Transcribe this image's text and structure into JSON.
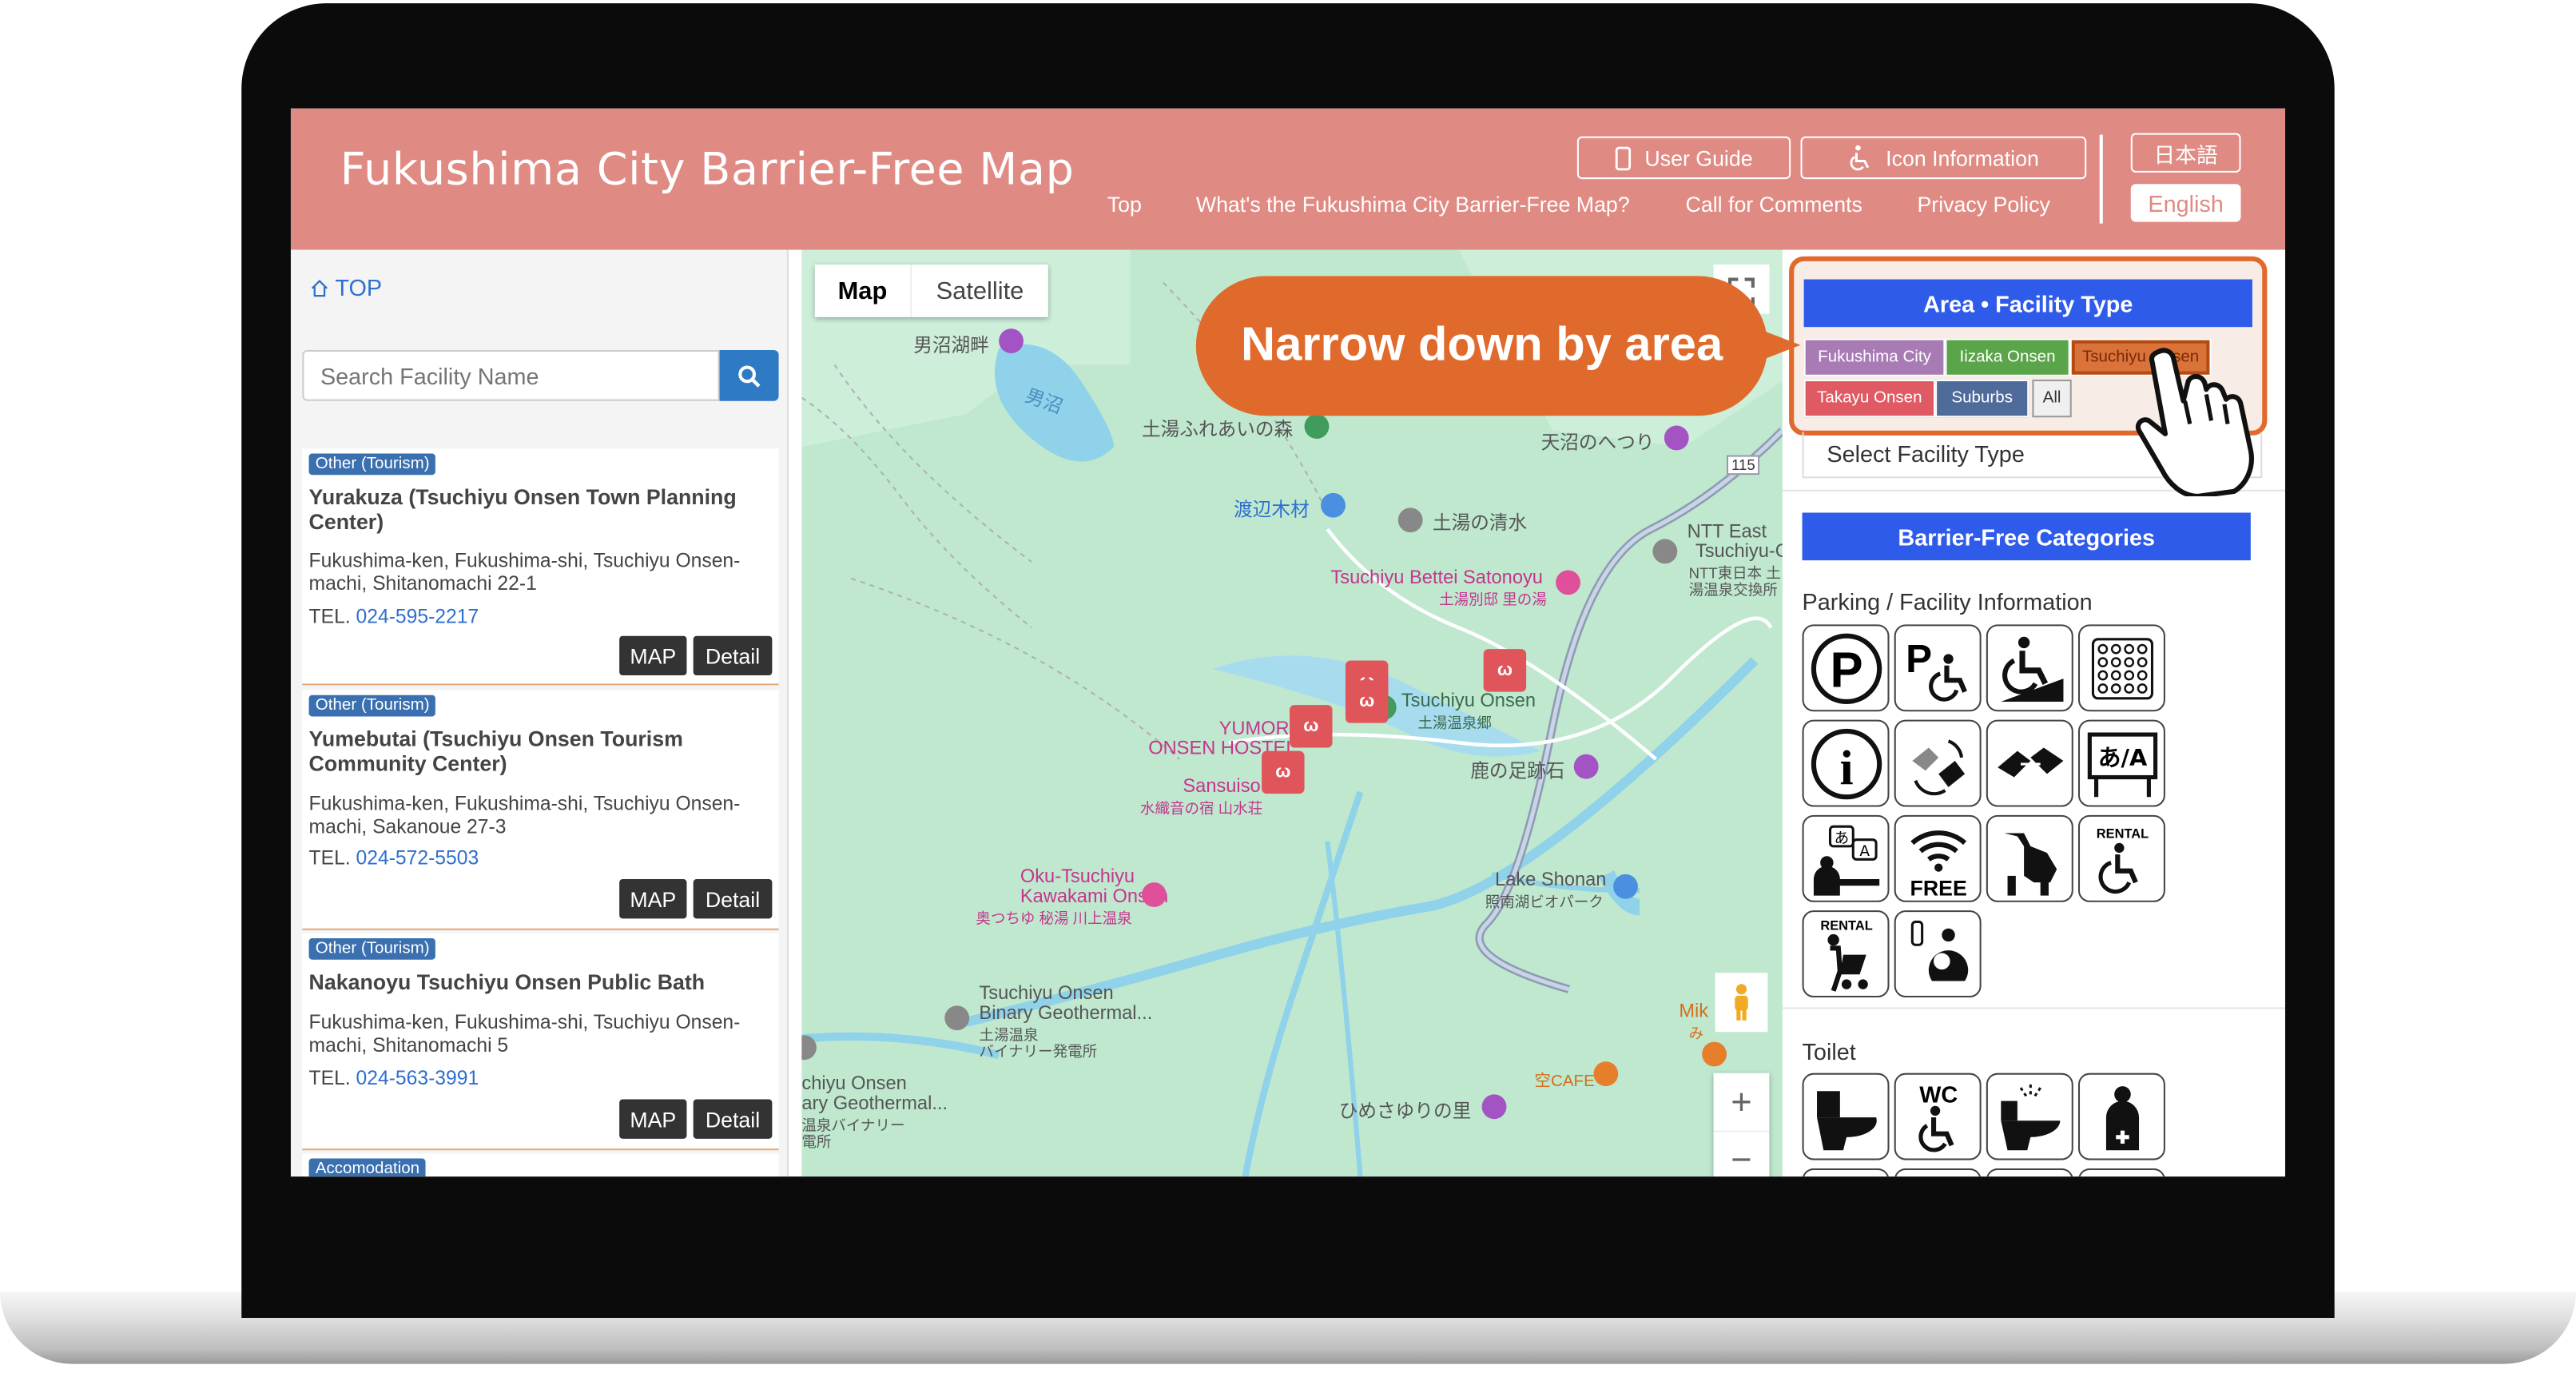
{
  "header": {
    "title": "Fukushima City Barrier-Free Map",
    "user_guide": "User Guide",
    "icon_information": "Icon Information",
    "nav": [
      "Top",
      "What's the Fukushima City Barrier-Free Map?",
      "Call for Comments",
      "Privacy Policy"
    ],
    "lang_ja": "日本語",
    "lang_en": "English"
  },
  "sidebar": {
    "top_link": "TOP",
    "search_placeholder": "Search Facility Name",
    "map_btn": "MAP",
    "detail_btn": "Detail",
    "results": [
      {
        "tag": "Other (Tourism)",
        "name": "Yurakuza (Tsuchiyu Onsen Town Planning Center)",
        "address": "Fukushima-ken, Fukushima-shi, Tsuchiyu Onsen-machi, Shitanomachi 22-1",
        "tel_label": "TEL.",
        "tel": "024-595-2217"
      },
      {
        "tag": "Other (Tourism)",
        "name": "Yumebutai (Tsuchiyu Onsen Tourism Community Center)",
        "address": "Fukushima-ken, Fukushima-shi, Tsuchiyu Onsen-machi, Sakanoue 27-3",
        "tel_label": "TEL.",
        "tel": "024-572-5503"
      },
      {
        "tag": "Other (Tourism)",
        "name": "Nakanoyu Tsuchiyu Onsen Public Bath",
        "address": "Fukushima-ken, Fukushima-shi, Tsuchiyu Onsen-machi, Shitanomachi 5",
        "tel_label": "TEL.",
        "tel": "024-563-3991"
      },
      {
        "tag": "Accomodation"
      }
    ]
  },
  "map": {
    "type_map": "Map",
    "type_satellite": "Satellite",
    "labels": {
      "onuma_lake": "男沼湖畔",
      "onuma": "男沼",
      "fureai": "土湯ふれあいの森",
      "tennuma": "天沼のへつり",
      "watanabe": "渡辺木材",
      "shimizu": "土湯の清水",
      "ntt1": "NTT East",
      "ntt2": "Tsuchiyu-O",
      "ntt3": "NTT東日本 土",
      "ntt4": "湯温泉交換所",
      "route": "115",
      "satonoyu": "Tsuchiyu Bettei Satonoyu",
      "satonoyu_jp": "土湯別邸 里の湯",
      "tsuchiyu_onsen": "Tsuchiyu Onsen",
      "tsuchiyu_jp": "土湯温泉郷",
      "yumori1": "YUMORI",
      "yumori2": "ONSEN HOSTEL",
      "sansuiso": "Sansuiso",
      "sansuiso_jp": "水織音の宿 山水荘",
      "shika": "鹿の足跡石",
      "oku1": "Oku-Tsuchiyu",
      "oku2": "Kawakami Onsen",
      "oku_jp": "奥つちゆ 秘湯 川上温泉",
      "shonan": "Lake Shonan",
      "shonan_jp": "照南湖ビオパーク",
      "binary1": "Tsuchiyu Onsen",
      "binary2": "Binary Geothermal...",
      "binary3": "土湯温泉",
      "binary4": "バイナリー発電所",
      "binary_b1": "chiyu Onsen",
      "binary_b2": "ary Geothermal...",
      "binary_b3": "温泉バイナリー",
      "binary_b4": "電所",
      "mik": "Mik",
      "mik_jp": "み",
      "cafe": "空CAFE",
      "himesayuri": "ひめさゆりの里",
      "rabbit_glyph": "ω",
      "zoom_in": "+",
      "zoom_out": "−"
    }
  },
  "filters": {
    "area_header": "Area • Facility Type",
    "areas": [
      "Fukushima City",
      "Iizaka Onsen",
      "Tsuchiyu Onsen",
      "Takayu Onsen",
      "Suburbs",
      "All"
    ],
    "area_colors": [
      "#a87bb5",
      "#5aa44a",
      "#d9733a",
      "#e05a64",
      "#4e6b9a",
      "#f0f0f0"
    ],
    "select_type": "Select Facility Type",
    "bf_header": "Barrier-Free Categories",
    "parking_section": "Parking / Facility Information",
    "toilet_section": "Toilet",
    "icon_text": {
      "p": "P",
      "info": "i",
      "lang": "あ/A",
      "rental": "RENTAL",
      "free": "FREE",
      "wc": "WC",
      "a": "A",
      "ja": "あ"
    }
  },
  "callout": {
    "text": "Narrow down by area"
  }
}
